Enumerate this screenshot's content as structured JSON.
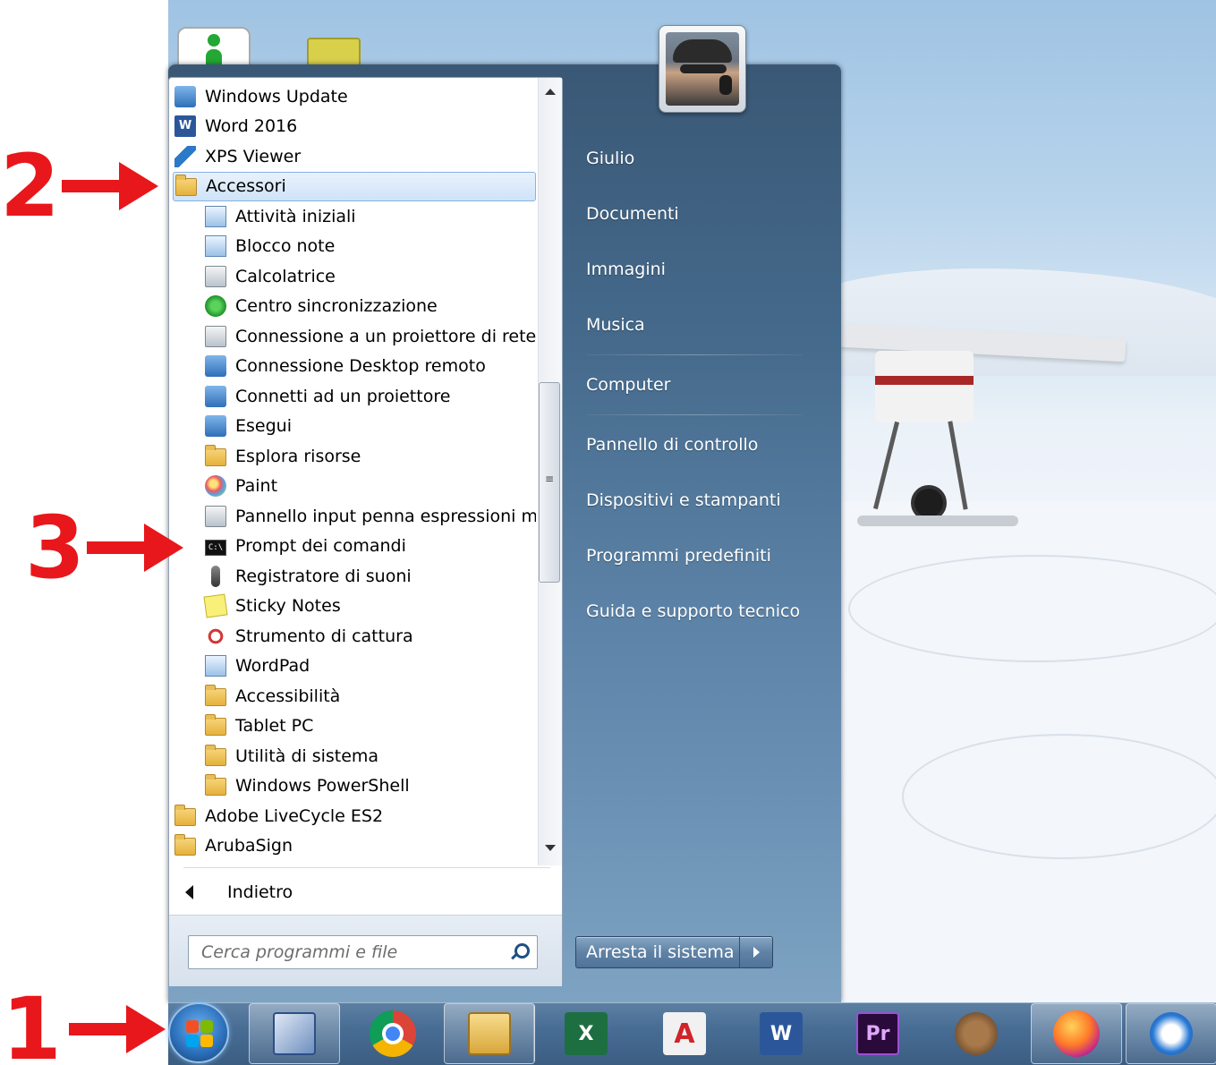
{
  "annotations": [
    {
      "label": "1",
      "target": "start-button"
    },
    {
      "label": "2",
      "target": "accessori-folder"
    },
    {
      "label": "3",
      "target": "prompt-dei-comandi"
    }
  ],
  "programs": [
    {
      "label": "Windows Update",
      "icon": "windows-update-icon",
      "indent": 0
    },
    {
      "label": "Word 2016",
      "icon": "word-icon",
      "indent": 0
    },
    {
      "label": "XPS Viewer",
      "icon": "xps-viewer-icon",
      "indent": 0
    },
    {
      "label": "Accessori",
      "icon": "folder-icon",
      "indent": 0,
      "selected": true
    },
    {
      "label": "Attività iniziali",
      "icon": "getting-started-icon",
      "indent": 1
    },
    {
      "label": "Blocco note",
      "icon": "notepad-icon",
      "indent": 1
    },
    {
      "label": "Calcolatrice",
      "icon": "calculator-icon",
      "indent": 1
    },
    {
      "label": "Centro sincronizzazione",
      "icon": "sync-center-icon",
      "indent": 1
    },
    {
      "label": "Connessione a un proiettore di rete",
      "icon": "network-projector-icon",
      "indent": 1
    },
    {
      "label": "Connessione Desktop remoto",
      "icon": "remote-desktop-icon",
      "indent": 1
    },
    {
      "label": "Connetti ad un proiettore",
      "icon": "projector-icon",
      "indent": 1
    },
    {
      "label": "Esegui",
      "icon": "run-icon",
      "indent": 1
    },
    {
      "label": "Esplora risorse",
      "icon": "explorer-icon",
      "indent": 1
    },
    {
      "label": "Paint",
      "icon": "paint-icon",
      "indent": 1
    },
    {
      "label": "Pannello input penna espressioni ma",
      "icon": "math-input-icon",
      "indent": 1
    },
    {
      "label": "Prompt dei comandi",
      "icon": "command-prompt-icon",
      "indent": 1
    },
    {
      "label": "Registratore di suoni",
      "icon": "microphone-icon",
      "indent": 1
    },
    {
      "label": "Sticky Notes",
      "icon": "sticky-notes-icon",
      "indent": 1
    },
    {
      "label": "Strumento di cattura",
      "icon": "snipping-tool-icon",
      "indent": 1
    },
    {
      "label": "WordPad",
      "icon": "wordpad-icon",
      "indent": 1
    },
    {
      "label": "Accessibilità",
      "icon": "folder-icon",
      "indent": 1
    },
    {
      "label": "Tablet PC",
      "icon": "folder-icon",
      "indent": 1
    },
    {
      "label": "Utilità di sistema",
      "icon": "folder-icon",
      "indent": 1
    },
    {
      "label": "Windows PowerShell",
      "icon": "folder-icon",
      "indent": 1
    },
    {
      "label": "Adobe LiveCycle ES2",
      "icon": "folder-icon",
      "indent": 0
    },
    {
      "label": "ArubaSign",
      "icon": "folder-icon",
      "indent": 0
    }
  ],
  "back_label": "Indietro",
  "search": {
    "placeholder": "Cerca programmi e file"
  },
  "right_pane": {
    "items": [
      "Giulio",
      "Documenti",
      "Immagini",
      "Musica",
      "Computer",
      "Pannello di controllo",
      "Dispositivi e stampanti",
      "Programmi predefiniti",
      "Guida e supporto tecnico"
    ]
  },
  "shutdown": {
    "label": "Arresta il sistema"
  },
  "taskbar": {
    "apps": [
      {
        "name": "remote-assistance-icon",
        "label": ""
      },
      {
        "name": "chrome-icon",
        "label": ""
      },
      {
        "name": "file-explorer-icon",
        "label": ""
      },
      {
        "name": "excel-icon",
        "label": "X"
      },
      {
        "name": "acrobat-icon",
        "label": "A"
      },
      {
        "name": "word-icon",
        "label": "W"
      },
      {
        "name": "premiere-icon",
        "label": "Pr"
      },
      {
        "name": "gimp-icon",
        "label": ""
      },
      {
        "name": "firefox-icon",
        "label": ""
      },
      {
        "name": "thunderbird-icon",
        "label": ""
      }
    ]
  },
  "colors": {
    "annotation": "#e8171b",
    "menu_blue": "#456a8c",
    "selection": "#cfe3f8"
  }
}
